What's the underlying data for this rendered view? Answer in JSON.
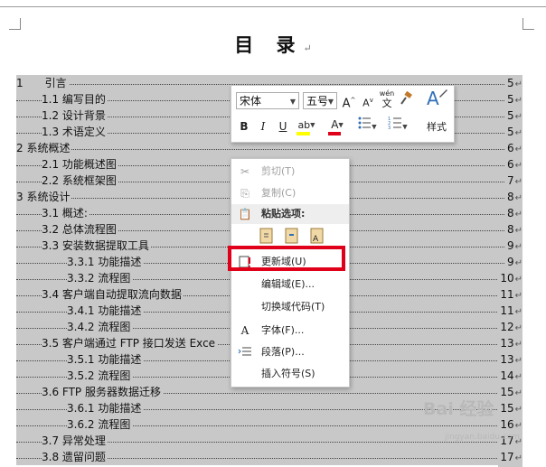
{
  "document": {
    "title": "目 录",
    "title_mark": "↵",
    "para_mark": "↵"
  },
  "toc": [
    {
      "label": "1　　引言",
      "page": "5"
    },
    {
      "label": "1.1 编写目的",
      "page": "5"
    },
    {
      "label": "1.2 设计背景",
      "page": "5"
    },
    {
      "label": "1.3 术语定义",
      "page": "5"
    },
    {
      "label": "2 系统概述",
      "page": "6"
    },
    {
      "label": "2.1 功能概述图",
      "page": "6"
    },
    {
      "label": "2.2 系统框架图",
      "page": "7"
    },
    {
      "label": "3 系统设计",
      "page": "8"
    },
    {
      "label": "3.1 概述:",
      "page": "8"
    },
    {
      "label": "3.2 总体流程图",
      "page": "8"
    },
    {
      "label": "3.3 安装数据提取工具",
      "page": "9"
    },
    {
      "label": "3.3.1 功能描述",
      "page": "9"
    },
    {
      "label": "3.3.2 流程图",
      "page": "10"
    },
    {
      "label": "3.4 客户端自动提取流向数据",
      "page": "11"
    },
    {
      "label": "3.4.1 功能描述",
      "page": "11"
    },
    {
      "label": "3.4.2 流程图",
      "page": "12"
    },
    {
      "label": "3.5 客户端通过 FTP 接口发送 Exce",
      "page": "13"
    },
    {
      "label": "3.5.1 功能描述",
      "page": "13"
    },
    {
      "label": "3.5.2 流程图",
      "page": "14"
    },
    {
      "label": "3.6 FTP 服务器数据迁移",
      "page": "15"
    },
    {
      "label": "3.6.1 功能描述",
      "page": "15"
    },
    {
      "label": "3.6.2 流程图",
      "page": "16"
    },
    {
      "label": "3.7 异常处理",
      "page": "17"
    },
    {
      "label": "3.8 遗留问题",
      "page": "17"
    }
  ],
  "mini_toolbar": {
    "font_name": "宋体",
    "font_size": "五号",
    "grow_font": "A",
    "shrink_font": "A",
    "phonetic": "wén",
    "bold": "B",
    "italic": "I",
    "underline": "U",
    "highlight": "ab",
    "font_color": "A",
    "styles_label": "样式",
    "highlight_color": "#ffff00",
    "font_color_value": "#e0001a"
  },
  "context_menu": {
    "cut": "剪切(T)",
    "copy": "复制(C)",
    "paste_options": "粘贴选项:",
    "update_field": "更新域(U)",
    "edit_field": "编辑域(E)...",
    "toggle_field_codes": "切换域代码(T)",
    "font": "字体(F)...",
    "paragraph": "段落(P)...",
    "insert_symbol": "插入符号(S)"
  },
  "watermark": {
    "text": "Bai 经验",
    "sub": "jingyan.baidu.com"
  },
  "colors": {
    "selection": "#c8c8c8",
    "highlight_box": "#e0001a"
  }
}
